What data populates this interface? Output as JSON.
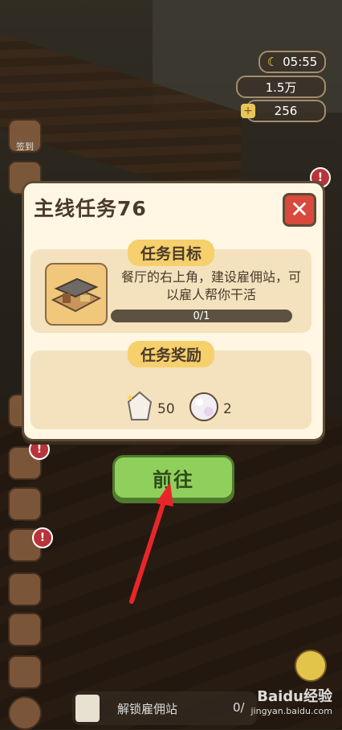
{
  "hud": {
    "time": "05:55",
    "coins": "1.5万",
    "gems": "256"
  },
  "side": {
    "sign_in_label": "签到"
  },
  "modal": {
    "title": "主线任务76",
    "close_symbol": "✕",
    "objective": {
      "label": "任务目标",
      "description": "餐厅的右上角，建设雇佣站，可以雇人帮你干活",
      "progress_text": "0/1",
      "progress_value": 0
    },
    "reward": {
      "label": "任务奖励",
      "items": [
        {
          "icon": "crystal-icon",
          "count": "50"
        },
        {
          "icon": "pearl-icon",
          "count": "2"
        }
      ]
    }
  },
  "goto_button": {
    "label": "前往"
  },
  "bottom": {
    "task_text": "解锁雇佣站",
    "task_progress": "0/"
  },
  "watermark": {
    "brand": "Baidu经验",
    "url": "jingyan.baidu.com"
  },
  "colors": {
    "goto": "#8fd05c",
    "close": "#d9493d",
    "label_bg": "#f5d06c",
    "arrow": "#e8262a"
  }
}
